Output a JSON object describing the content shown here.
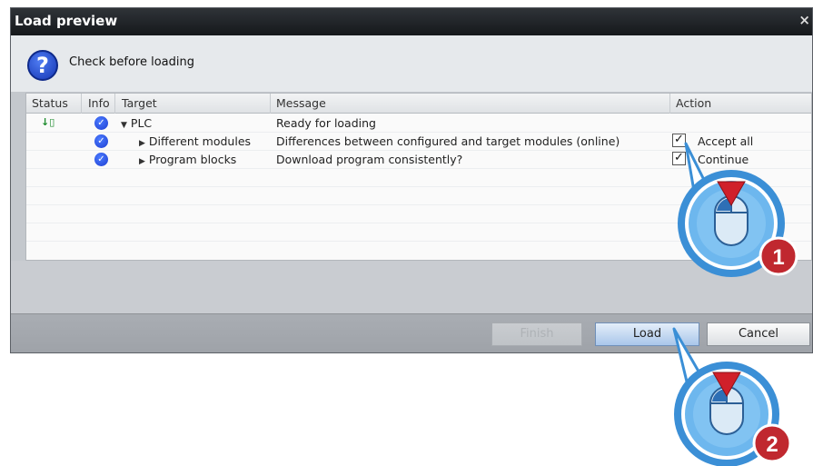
{
  "dialog": {
    "title": "Load preview",
    "close_glyph": "×",
    "subtitle": "Check before loading",
    "question_glyph": "?"
  },
  "table": {
    "headers": {
      "status": "Status",
      "info": "Info",
      "target": "Target",
      "message": "Message",
      "action": "Action"
    },
    "rows": [
      {
        "status": "↓▯",
        "info": "✓",
        "target": "PLC",
        "message": "Ready for loading",
        "action": ""
      },
      {
        "status": "",
        "info": "✓",
        "target": "Different modules",
        "message": "Differences between configured and target modules (online)",
        "action": "Accept all",
        "checked": true
      },
      {
        "status": "",
        "info": "✓",
        "target": "Program blocks",
        "message": "Download program consistently?",
        "action": "Continue",
        "checked": true
      }
    ]
  },
  "buttons": {
    "finish": "Finish",
    "load": "Load",
    "cancel": "Cancel"
  },
  "callouts": [
    {
      "number": "1"
    },
    {
      "number": "2"
    }
  ],
  "colors": {
    "accent_blue": "#1f3fd2",
    "callout_blue": "#5ba6e6",
    "callout_red": "#c0282f",
    "arrow_red": "#d0202a"
  }
}
